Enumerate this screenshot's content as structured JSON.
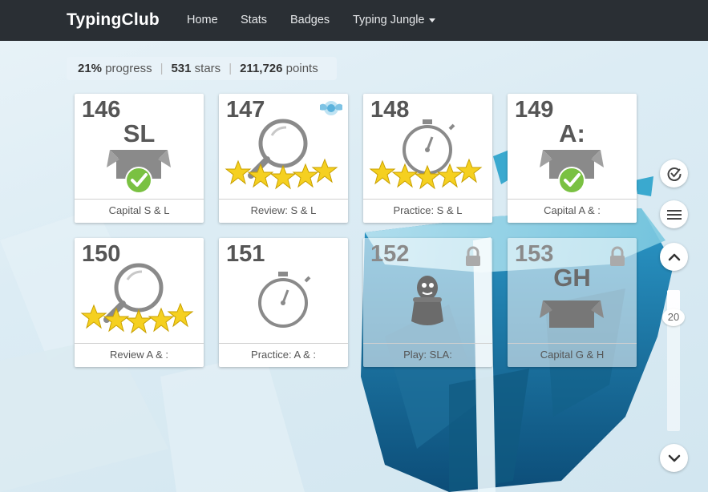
{
  "nav": {
    "brand": "TypingClub",
    "items": [
      {
        "label": "Home"
      },
      {
        "label": "Stats"
      },
      {
        "label": "Badges"
      },
      {
        "label": "Typing Jungle"
      }
    ]
  },
  "progress": {
    "percent": "21%",
    "percent_label": "progress",
    "stars": "531",
    "stars_label": "stars",
    "points": "211,726",
    "points_label": "points"
  },
  "lessons": [
    {
      "number": "146",
      "type": "box",
      "badge_text": "SL",
      "caption": "Capital S & L",
      "completed": true,
      "stars": 0,
      "locked": false
    },
    {
      "number": "147",
      "type": "review",
      "badge_text": "",
      "caption": "Review: S & L",
      "completed": false,
      "stars": 5,
      "locked": false,
      "special_badge": "wings-badge-icon"
    },
    {
      "number": "148",
      "type": "timer",
      "badge_text": "",
      "caption": "Practice: S & L",
      "completed": false,
      "stars": 5,
      "locked": false
    },
    {
      "number": "149",
      "type": "box",
      "badge_text": "A:",
      "caption": "Capital A & :",
      "completed": true,
      "stars": 0,
      "locked": false
    },
    {
      "number": "150",
      "type": "review",
      "badge_text": "",
      "caption": "Review A & :",
      "completed": false,
      "stars": 5,
      "locked": false
    },
    {
      "number": "151",
      "type": "timer",
      "badge_text": "",
      "caption": "Practice: A & :",
      "completed": false,
      "stars": 0,
      "locked": false
    },
    {
      "number": "152",
      "type": "game",
      "badge_text": "",
      "caption": "Play: SLA:",
      "completed": false,
      "stars": 0,
      "locked": true
    },
    {
      "number": "153",
      "type": "box",
      "badge_text": "GH",
      "caption": "Capital G & H",
      "completed": false,
      "stars": 0,
      "locked": true
    }
  ],
  "sidebar": {
    "goals_icon": "check-circle-icon",
    "menu_icon": "hamburger-icon",
    "up_icon": "chevron-up-icon",
    "down_icon": "chevron-down-icon",
    "scroll_value": "20"
  },
  "colors": {
    "navbar": "#2a2f34",
    "star": "#f5d020",
    "check": "#7ac142",
    "icon_gray": "#8a8a8a"
  }
}
